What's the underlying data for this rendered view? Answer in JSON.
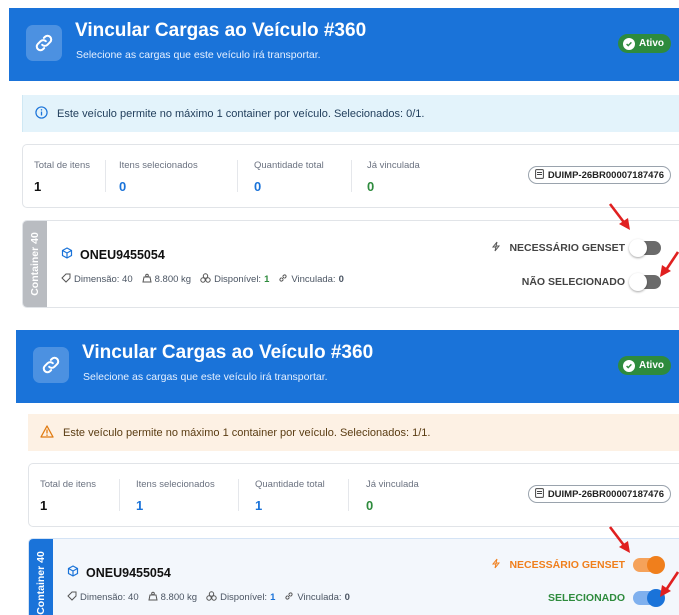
{
  "before": {
    "header": {
      "title": "Vincular Cargas ao Veículo #360",
      "subtitle": "Selecione as cargas que este veículo irá transportar.",
      "status_badge": "Ativo"
    },
    "alert": {
      "text": "Este veículo permite no máximo 1 container por veículo. Selecionados: 0/1."
    },
    "stats": {
      "total_label": "Total de itens",
      "total_value": "1",
      "selected_label": "Itens selecionados",
      "selected_value": "0",
      "qty_label": "Quantidade total",
      "qty_value": "0",
      "linked_label": "Já vinculada",
      "linked_value": "0",
      "duimp": "DUIMP-26BR00007187476"
    },
    "card": {
      "tag": "Container 40",
      "name": "ONEU9455054",
      "dimension": "Dimensão: 40",
      "weight": "8.800 kg",
      "available_label": "Disponível:",
      "available_value": "1",
      "linked_label": "Vinculada:",
      "linked_value": "0",
      "genset_label": "NECESSÁRIO GENSET",
      "genset_on": false,
      "select_label": "NÃO SELECIONADO",
      "select_on": false
    }
  },
  "after": {
    "header": {
      "title": "Vincular Cargas ao Veículo #360",
      "subtitle": "Selecione as cargas que este veículo irá transportar.",
      "status_badge": "Ativo"
    },
    "alert": {
      "text": "Este veículo permite no máximo 1 container por veículo. Selecionados: 1/1."
    },
    "stats": {
      "total_label": "Total de itens",
      "total_value": "1",
      "selected_label": "Itens selecionados",
      "selected_value": "1",
      "qty_label": "Quantidade total",
      "qty_value": "1",
      "linked_label": "Já vinculada",
      "linked_value": "0",
      "duimp": "DUIMP-26BR00007187476"
    },
    "card": {
      "tag": "Container 40",
      "name": "ONEU9455054",
      "dimension": "Dimensão: 40",
      "weight": "8.800 kg",
      "available_label": "Disponível:",
      "available_value": "1",
      "linked_label": "Vinculada:",
      "linked_value": "0",
      "genset_label": "NECESSÁRIO GENSET",
      "genset_on": true,
      "select_label": "SELECIONADO",
      "select_on": true
    }
  },
  "colors": {
    "header_blue": "#1a73d9",
    "active_green": "#2e8b3d",
    "value_blue": "#1a73d9",
    "value_green": "#2e8b3d",
    "genset_orange": "#f07f1c",
    "annotation_red": "#e02020"
  },
  "icons": [
    "link-icon",
    "check-circle-icon",
    "info-icon",
    "warning-icon",
    "document-icon",
    "cube-icon",
    "tag-icon",
    "weight-icon",
    "boxes-icon",
    "link-small-icon",
    "bolt-icon",
    "red-arrow-icon"
  ]
}
